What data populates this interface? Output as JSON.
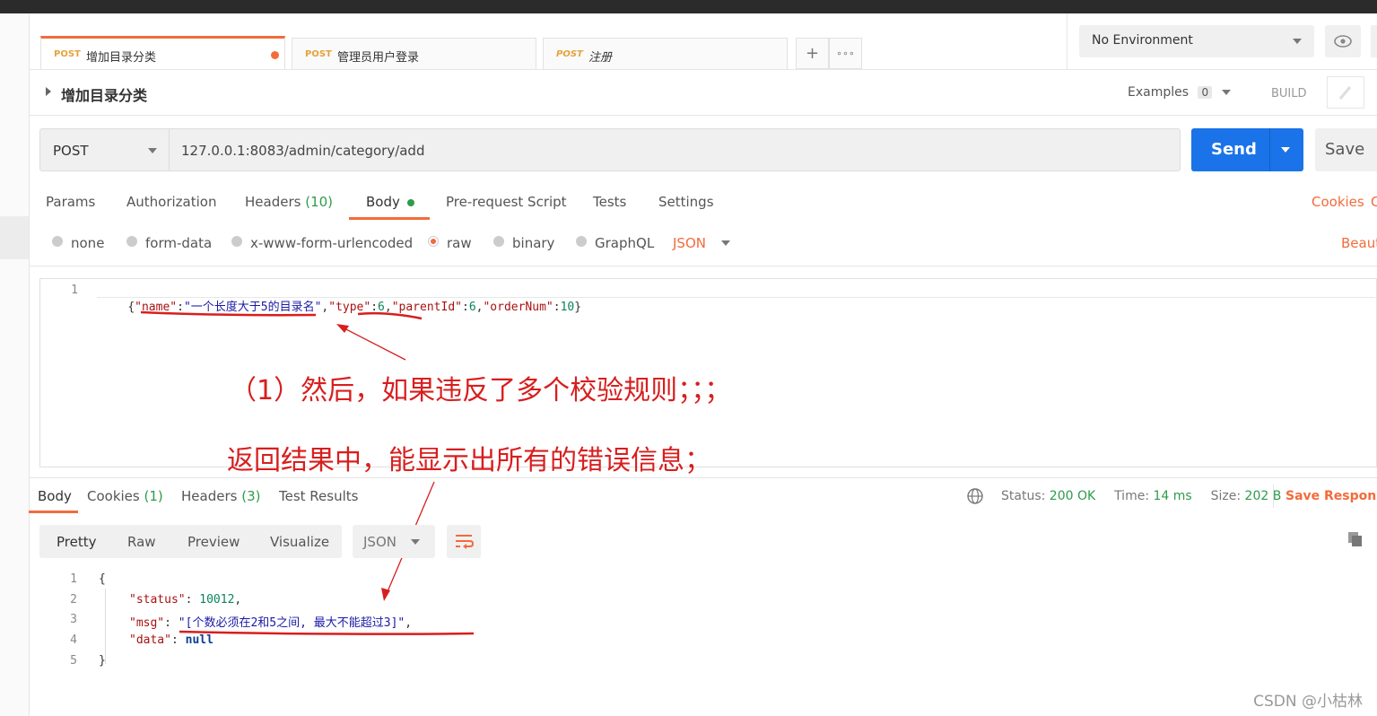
{
  "tabs": [
    {
      "method": "POST",
      "title": "增加目录分类"
    },
    {
      "method": "POST",
      "title": "管理员用户登录"
    },
    {
      "method": "POST",
      "title": "注册"
    }
  ],
  "tab_actions": {
    "add": "+",
    "more": "∘∘∘"
  },
  "environment": {
    "selected": "No Environment"
  },
  "request": {
    "title": "增加目录分类",
    "examples_label": "Examples",
    "examples_count": "0",
    "build_label": "BUILD",
    "method": "POST",
    "url": "127.0.0.1:8083/admin/category/add",
    "send_label": "Send",
    "save_label": "Save"
  },
  "request_tabs": {
    "params": "Params",
    "authorization": "Authorization",
    "headers": "Headers",
    "headers_count": "(10)",
    "body": "Body",
    "prerequest": "Pre-request Script",
    "tests": "Tests",
    "settings": "Settings",
    "cookies": "Cookies",
    "cookies_cut": "C"
  },
  "body_types": {
    "none": "none",
    "form_data": "form-data",
    "urlencoded": "x-www-form-urlencoded",
    "raw": "raw",
    "binary": "binary",
    "graphql": "GraphQL",
    "json": "JSON",
    "beautify": "Beaut"
  },
  "request_body": {
    "line": "1",
    "brace_open": "{",
    "k1": "\"name\"",
    "colon": ":",
    "v1": "\"一个长度大于5的目录名\"",
    "comma": ",",
    "k2": "\"type\"",
    "v2": "6",
    "k3": "\"parentId\"",
    "v3": "6",
    "k4": "\"orderNum\"",
    "v4": "10",
    "brace_close": "}"
  },
  "annotations": {
    "line1": "（1）然后，如果违反了多个校验规则；；；",
    "line2": "返回结果中，能显示出所有的错误信息；"
  },
  "response_tabs": {
    "body": "Body",
    "cookies": "Cookies",
    "cookies_count": "(1)",
    "headers": "Headers",
    "headers_count": "(3)",
    "test_results": "Test Results"
  },
  "response_meta": {
    "status_label": "Status:",
    "status_value": "200 OK",
    "time_label": "Time:",
    "time_value": "14 ms",
    "size_label": "Size:",
    "size_value": "202 B",
    "save_response": "Save Response"
  },
  "response_view": {
    "pretty": "Pretty",
    "raw": "Raw",
    "preview": "Preview",
    "visualize": "Visualize",
    "format": "JSON"
  },
  "response_body": {
    "l1": "1",
    "l2": "2",
    "l3": "3",
    "l4": "4",
    "l5": "5",
    "open": "{",
    "k_status": "\"status\"",
    "v_status": "10012",
    "k_msg": "\"msg\"",
    "v_msg": "\"[个数必须在2和5之间, 最大不能超过3]\"",
    "k_data": "\"data\"",
    "v_data": "null",
    "close": "}",
    "sep": ": ",
    "comma": ","
  },
  "watermark": "CSDN @小枯林",
  "colors": {
    "accent": "#f26b3a",
    "send": "#1a73e8",
    "annotation": "#d81e1e",
    "status_green": "#2e9c4b"
  }
}
